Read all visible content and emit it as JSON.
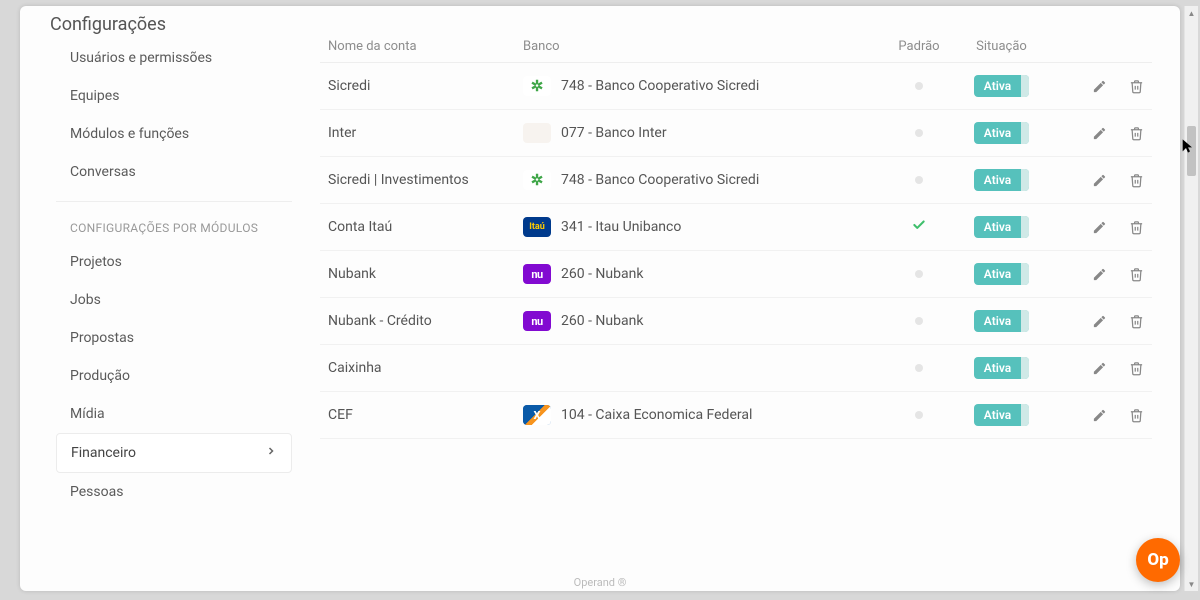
{
  "page": {
    "title": "Configurações",
    "footer": "Operand ®"
  },
  "sidebar": {
    "group1": [
      {
        "label": "Usuários e permissões"
      },
      {
        "label": "Equipes"
      },
      {
        "label": "Módulos e funções"
      },
      {
        "label": "Conversas"
      }
    ],
    "section_header": "CONFIGURAÇÕES POR MÓDULOS",
    "group2": [
      {
        "label": "Projetos"
      },
      {
        "label": "Jobs"
      },
      {
        "label": "Propostas"
      },
      {
        "label": "Produção"
      },
      {
        "label": "Mídia"
      },
      {
        "label": "Financeiro",
        "active": true
      },
      {
        "label": "Pessoas"
      }
    ]
  },
  "table": {
    "headers": {
      "name": "Nome da conta",
      "bank": "Banco",
      "default": "Padrão",
      "status": "Situação"
    },
    "status_active": "Ativa",
    "rows": [
      {
        "name": "Sicredi",
        "bank": "748 - Banco Cooperativo Sicredi",
        "logo": "sicredi",
        "logo_text": "✲",
        "default": false
      },
      {
        "name": "Inter",
        "bank": "077 - Banco Inter",
        "logo": "inter",
        "logo_text": "",
        "default": false
      },
      {
        "name": "Sicredi | Investimentos",
        "bank": "748 - Banco Cooperativo Sicredi",
        "logo": "sicredi",
        "logo_text": "✲",
        "default": false
      },
      {
        "name": "Conta Itaú",
        "bank": "341 - Itau Unibanco",
        "logo": "itau",
        "logo_text": "Itaú",
        "default": true
      },
      {
        "name": "Nubank",
        "bank": "260 - Nubank",
        "logo": "nubank",
        "logo_text": "nu",
        "default": false
      },
      {
        "name": "Nubank - Crédito",
        "bank": "260 - Nubank",
        "logo": "nubank",
        "logo_text": "nu",
        "default": false
      },
      {
        "name": "Caixinha",
        "bank": "",
        "logo": "caixinha",
        "logo_text": "",
        "default": false
      },
      {
        "name": "CEF",
        "bank": "104 - Caixa Economica Federal",
        "logo": "cef",
        "logo_text": "X",
        "default": false
      }
    ]
  },
  "float": {
    "label": "Op"
  }
}
